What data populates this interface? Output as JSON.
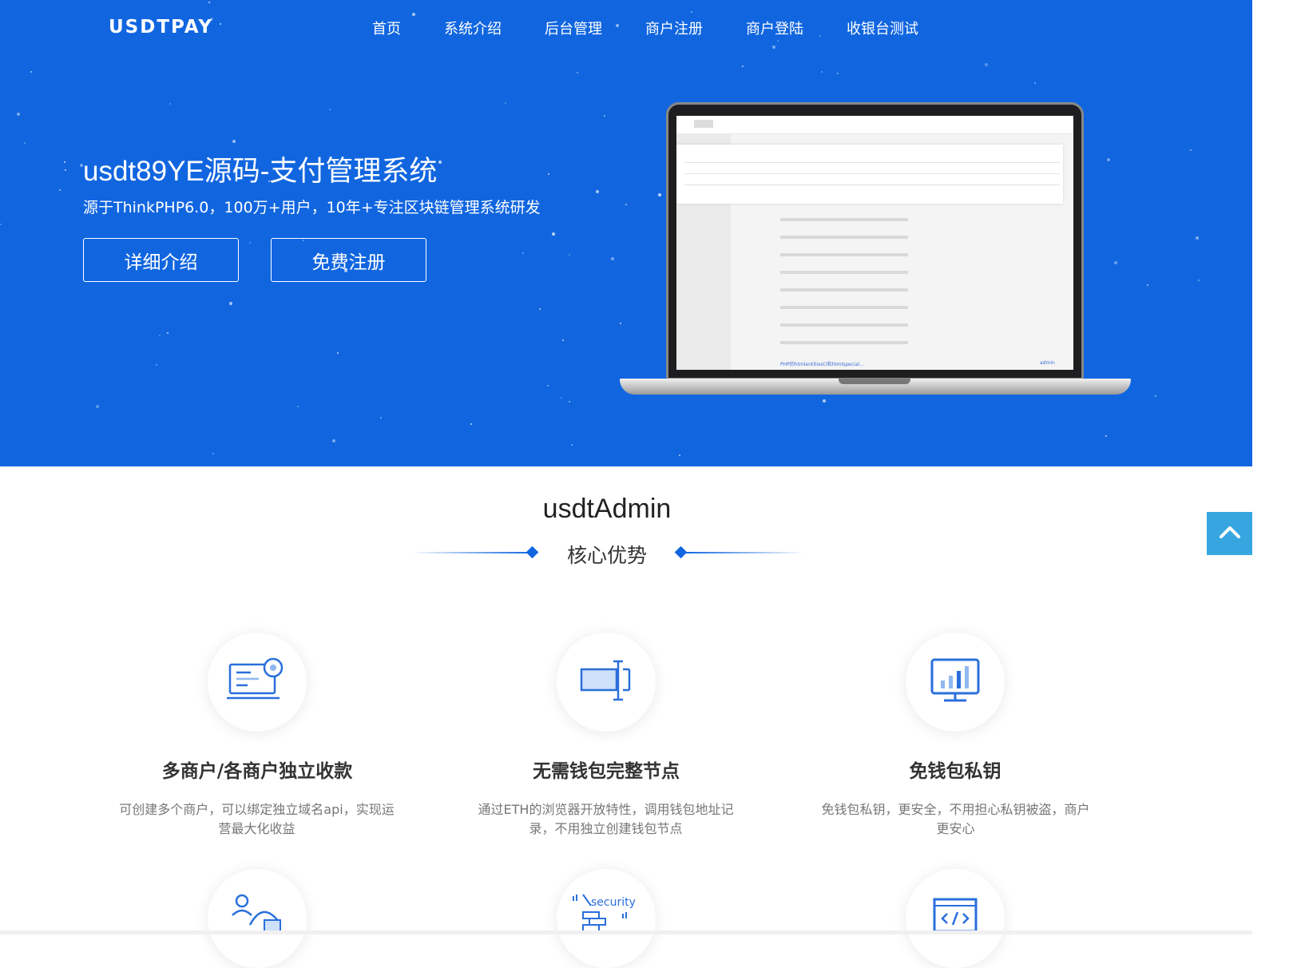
{
  "brand": {
    "logo_text": "USDTPAY"
  },
  "nav": {
    "items": [
      {
        "label": "首页"
      },
      {
        "label": "系统介绍"
      },
      {
        "label": "后台管理"
      },
      {
        "label": "商户注册"
      },
      {
        "label": "商户登陆"
      },
      {
        "label": "收银台测试"
      }
    ]
  },
  "hero": {
    "title": "usdt89YE源码-支付管理系统",
    "subtitle": "源于ThinkPHP6.0，100万+用户，10年+专注区块链管理系统研发",
    "buttons": {
      "detail": "详细介绍",
      "register": "免费注册"
    },
    "screen_last_row_text": "PHP的htmlentities()和htmlspecial...",
    "screen_last_row_user": "admin"
  },
  "section": {
    "title": "usdtAdmin",
    "subtitle": "核心优势"
  },
  "features": [
    {
      "icon": "merchant-settings-icon",
      "title": "多商户/各商户独立收款",
      "desc": "可创建多个商户，可以绑定独立域名api，实现运营最大化收益"
    },
    {
      "icon": "wallet-node-icon",
      "title": "无需钱包完整节点",
      "desc": "通过ETH的浏览器开放特性，调用钱包地址记录，不用独立创建钱包节点"
    },
    {
      "icon": "monitor-chart-icon",
      "title": "免钱包私钥",
      "desc": "免钱包私钥，更安全，不用担心私钥被盗，商户更安心"
    }
  ],
  "features_row2": [
    {
      "icon": "users-icon"
    },
    {
      "icon": "security-icon",
      "label": "security"
    },
    {
      "icon": "code-window-icon"
    }
  ],
  "colors": {
    "primary": "#1166e0",
    "back_to_top": "#37a6e0"
  }
}
